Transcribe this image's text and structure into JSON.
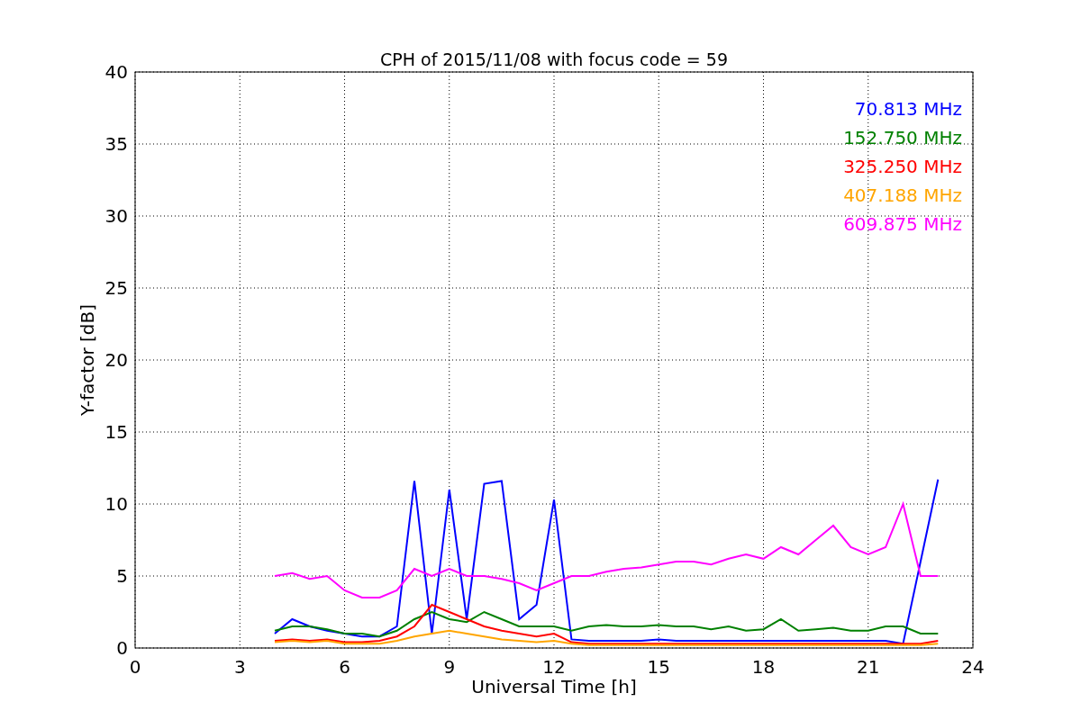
{
  "figure": {
    "chart_data": {
      "type": "line",
      "title": "CPH of 2015/11/08 with focus code = 59",
      "xlabel": "Universal Time [h]",
      "ylabel": "Y-factor [dB]",
      "x": [
        4,
        4.5,
        5,
        5.5,
        6,
        6.5,
        7,
        7.5,
        8,
        8.5,
        9,
        9.5,
        10,
        10.5,
        11,
        11.5,
        12,
        12.5,
        13,
        13.5,
        14,
        14.5,
        15,
        15.5,
        16,
        16.5,
        17,
        17.5,
        18,
        18.5,
        19,
        19.5,
        20,
        20.5,
        21,
        21.5,
        22,
        22.5,
        23
      ],
      "series": [
        {
          "name": "70.813 MHz",
          "color": "#0000ff",
          "values": [
            1,
            2,
            1.5,
            1.2,
            1,
            0.8,
            0.8,
            1.5,
            11.6,
            1,
            11,
            2,
            11.4,
            11.6,
            2,
            3,
            10.3,
            0.6,
            0.5,
            0.5,
            0.5,
            0.5,
            0.6,
            0.5,
            0.5,
            0.5,
            0.5,
            0.5,
            0.5,
            0.5,
            0.5,
            0.5,
            0.5,
            0.5,
            0.5,
            0.5,
            0.3,
            6,
            11.7
          ]
        },
        {
          "name": "152.750 MHz",
          "color": "#008000",
          "values": [
            1.2,
            1.5,
            1.5,
            1.3,
            1,
            1,
            0.8,
            1.2,
            2,
            2.5,
            2,
            1.8,
            2.5,
            2,
            1.5,
            1.5,
            1.5,
            1.2,
            1.5,
            1.6,
            1.5,
            1.5,
            1.6,
            1.5,
            1.5,
            1.3,
            1.5,
            1.2,
            1.3,
            2,
            1.2,
            1.3,
            1.4,
            1.2,
            1.2,
            1.5,
            1.5,
            1,
            1
          ]
        },
        {
          "name": "325.250 MHz",
          "color": "#ff0000",
          "values": [
            0.5,
            0.6,
            0.5,
            0.6,
            0.4,
            0.4,
            0.5,
            0.8,
            1.5,
            3,
            2.5,
            2,
            1.5,
            1.2,
            1,
            0.8,
            1,
            0.4,
            0.3,
            0.3,
            0.3,
            0.3,
            0.3,
            0.3,
            0.3,
            0.3,
            0.3,
            0.3,
            0.3,
            0.3,
            0.3,
            0.3,
            0.3,
            0.3,
            0.3,
            0.3,
            0.3,
            0.3,
            0.5
          ]
        },
        {
          "name": "407.188 MHz",
          "color": "#ffa500",
          "values": [
            0.4,
            0.5,
            0.4,
            0.5,
            0.3,
            0.3,
            0.3,
            0.5,
            0.8,
            1,
            1.2,
            1,
            0.8,
            0.6,
            0.5,
            0.4,
            0.5,
            0.3,
            0.2,
            0.2,
            0.2,
            0.2,
            0.2,
            0.2,
            0.2,
            0.2,
            0.2,
            0.2,
            0.2,
            0.2,
            0.2,
            0.2,
            0.2,
            0.2,
            0.2,
            0.2,
            0.2,
            0.2,
            0.3
          ]
        },
        {
          "name": "609.875 MHz",
          "color": "#ff00ff",
          "values": [
            5,
            5.2,
            4.8,
            5,
            4,
            3.5,
            3.5,
            4,
            5.5,
            5,
            5.5,
            5,
            5,
            4.8,
            4.5,
            4,
            4.5,
            5,
            5,
            5.3,
            5.5,
            5.6,
            5.8,
            6,
            6,
            5.8,
            6.2,
            6.5,
            6.2,
            7,
            6.5,
            7.5,
            8.5,
            7,
            6.5,
            7,
            10,
            5,
            5
          ]
        }
      ],
      "grid": true,
      "xlim": [
        0,
        24
      ],
      "ylim": [
        0,
        40
      ],
      "xticks": [
        0,
        3,
        6,
        9,
        12,
        15,
        18,
        21,
        24
      ],
      "yticks": [
        0,
        5,
        10,
        15,
        20,
        25,
        30,
        35,
        40
      ]
    }
  }
}
